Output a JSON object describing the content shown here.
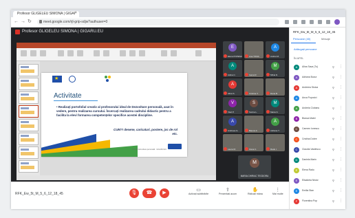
{
  "browser": {
    "tab_title": "Profesor GLIGELEU SIMONA | GIGARU.EU",
    "url": "meet.google.com/rjl-grip-sdjw?authuser=0"
  },
  "meet": {
    "presenter": "Profesor GLIGELEU SIMONA | GIGARU.EU",
    "meeting_code": "RFK_Ew_5t_M_5_6_12_18_45",
    "panel_title": "RFK_Ew_5t_M_5_6_12_18_45",
    "tab_people": "Persoane (40)",
    "tab_chat": "Mesaje",
    "add_people": "Adăugați persoane",
    "section_label": "ÎN APEL",
    "controls": {
      "mic_icon": "mic-off-icon",
      "hangup_icon": "phone-hangup-icon",
      "cam_icon": "camera-off-icon",
      "captions_label": "Activați subtitrările",
      "present_label": "Prezentați acum",
      "raise_label": "Ridicați mâna",
      "more_label": "Mai multe"
    }
  },
  "slide": {
    "title": "Activitate",
    "body": "• Realizați portofoliul creativ al profesorului ideal de Dezvoltare personală, axat în vedere, pentru realizarea cursului. Încercați realizarea cadrului didactic pentru a facilita la elevi formarea competențelor specifice acestei discipline.",
    "note": "CUM?! desene, caricaturi, postere, joc de rol etc.",
    "footer": "Ora de Dezvoltare personală · GIGARU.EU",
    "badge": "CRED"
  },
  "participants_grid": [
    {
      "initial": "E",
      "color": "#7e57c2",
      "name": "Elena POPESCU"
    },
    {
      "initial": "",
      "color": "#3c4043",
      "name": "Ana TOMA",
      "camera": true
    },
    {
      "initial": "A",
      "color": "#1e88e5",
      "name": "Andrei M."
    },
    {
      "initial": "A",
      "color": "#00897b",
      "name": "Adina C."
    },
    {
      "initial": "",
      "color": "#3c4043",
      "name": "Ioana R.",
      "camera": true
    },
    {
      "initial": "M",
      "color": "#43a047",
      "name": "Mihai D."
    },
    {
      "initial": "A",
      "color": "#e53935",
      "name": "Alina S."
    },
    {
      "initial": "",
      "color": "#3c4043",
      "name": "Cristina V.",
      "camera": true
    },
    {
      "initial": "",
      "color": "#3c4043",
      "name": "Dana B.",
      "camera": true
    },
    {
      "initial": "V",
      "color": "#8e24aa",
      "name": "Vlad P."
    },
    {
      "initial": "S",
      "color": "#6d4c41",
      "name": "Sorina L."
    },
    {
      "initial": "M",
      "color": "#00897b",
      "name": "Maria N."
    },
    {
      "initial": "A",
      "color": "#3949ab",
      "name": "Andreea G."
    },
    {
      "initial": "",
      "color": "#3c4043",
      "name": "Bianca F.",
      "camera": true
    },
    {
      "initial": "A",
      "color": "#43a047",
      "name": "Adriana T."
    },
    {
      "initial": "",
      "color": "#3c4043",
      "name": "Laura M.",
      "camera": true
    },
    {
      "initial": "",
      "color": "#3c4043",
      "name": "Oana C.",
      "camera": true
    },
    {
      "initial": "",
      "color": "#3c4043",
      "name": "Radu I.",
      "camera": true
    }
  ],
  "big_tile": {
    "initial": "M",
    "name": "MARIA CHIRIAC TEODORA"
  },
  "people": [
    {
      "initial": "A",
      "color": "#00897b",
      "name": "Alina Sava (Tu)"
    },
    {
      "initial": "A",
      "color": "#7e57c2",
      "name": "Adriana Bucur"
    },
    {
      "initial": "A",
      "color": "#e53935",
      "name": "Andreea Stoica"
    },
    {
      "initial": "A",
      "color": "#1e88e5",
      "name": "Anca Popovici"
    },
    {
      "initial": "A",
      "color": "#43a047",
      "name": "Andreia Ciobanu"
    },
    {
      "initial": "B",
      "color": "#8e24aa",
      "name": "Bianca Matei"
    },
    {
      "initial": "C",
      "color": "#6d4c41",
      "name": "Carmen Ionescu"
    },
    {
      "initial": "C",
      "color": "#f4511e",
      "name": "Cristina Dobre"
    },
    {
      "initial": "C",
      "color": "#3949ab",
      "name": "Claudia Vasilescu"
    },
    {
      "initial": "D",
      "color": "#00897b",
      "name": "Daniela Marin"
    },
    {
      "initial": "E",
      "color": "#c0ca33",
      "name": "Elena Radu"
    },
    {
      "initial": "E",
      "color": "#7e57c2",
      "name": "Elisabeta Nistor"
    },
    {
      "initial": "E",
      "color": "#1e88e5",
      "name": "Emilia Stan"
    },
    {
      "initial": "F",
      "color": "#e53935",
      "name": "Florentina Pop"
    }
  ]
}
